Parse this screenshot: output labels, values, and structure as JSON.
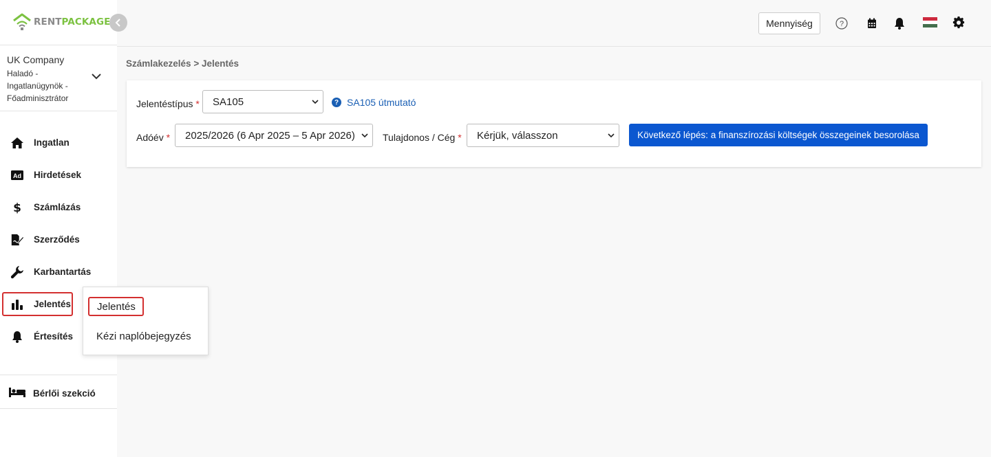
{
  "app": {
    "logo_rent": "RENT",
    "logo_package": "PACKAGE",
    "brand_green": "#7cc241"
  },
  "company": {
    "name": "UK Company",
    "role": "Haladó - Ingatlanügynök - Főadminisztrátor"
  },
  "sidebar": {
    "items": [
      {
        "label": "Ingatlan",
        "icon": "home-icon"
      },
      {
        "label": "Hirdetések",
        "icon": "ad-icon"
      },
      {
        "label": "Számlázás",
        "icon": "dollar-icon"
      },
      {
        "label": "Szerződés",
        "icon": "contract-icon"
      },
      {
        "label": "Karbantartás",
        "icon": "wrench-icon"
      },
      {
        "label": "Jelentés",
        "icon": "bar-chart-icon",
        "active": true
      },
      {
        "label": "Értesítés",
        "icon": "bell-icon"
      }
    ],
    "tenant_label": "Bérlői szekció"
  },
  "header": {
    "quantity_label": "Mennyiség",
    "icons": [
      "help-icon",
      "calendar-icon",
      "bell-icon",
      "hungarian-flag-icon",
      "gear-icon"
    ]
  },
  "breadcrumb": "Számlakezelés > Jelentés",
  "form": {
    "report_type_label": "Jelentéstípus",
    "report_type_value": "SA105",
    "help_link": "SA105 útmutató",
    "tax_year_label": "Adóév",
    "tax_year_value": "2025/2026 (6 Apr 2025 – 5 Apr 2026)",
    "owner_label": "Tulajdonos / Cég",
    "owner_value": "Kérjük, válasszon",
    "next_button": "Következő lépés: a finanszírozási költségek összegeinek besorolása",
    "required_mark": "*"
  },
  "popup": {
    "items": [
      "Jelentés",
      "Kézi naplóbejegyzés"
    ]
  }
}
